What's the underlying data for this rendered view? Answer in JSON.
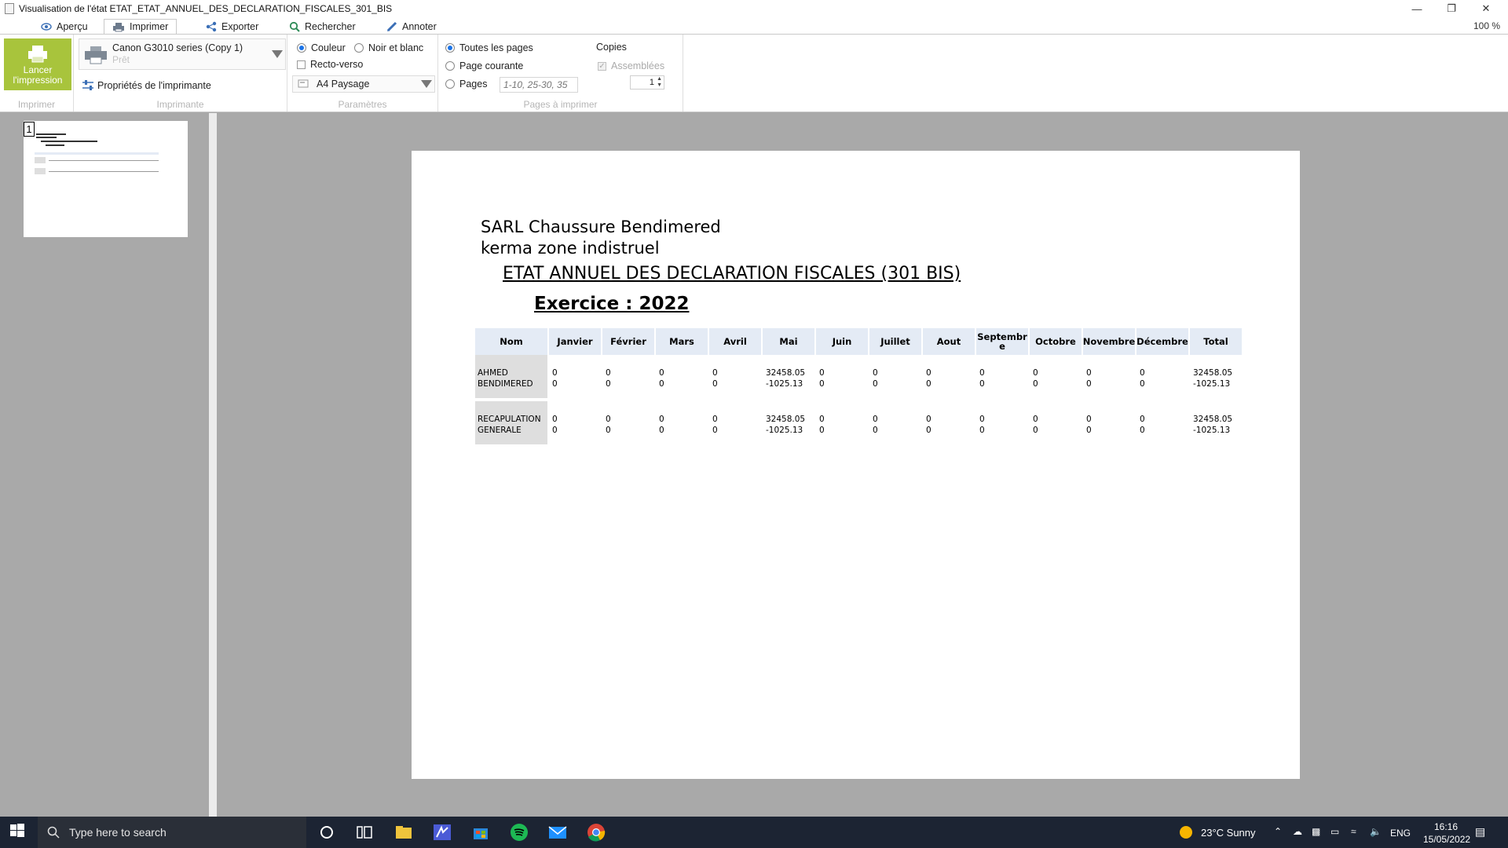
{
  "window": {
    "title": "Visualisation de l'état ETAT_ETAT_ANNUEL_DES_DECLARATION_FISCALES_301_BIS",
    "zoom": "100 %"
  },
  "tabs": [
    {
      "label": "Aperçu",
      "icon": "eye-icon"
    },
    {
      "label": "Imprimer",
      "icon": "printer-icon"
    },
    {
      "label": "Exporter",
      "icon": "share-icon"
    },
    {
      "label": "Rechercher",
      "icon": "search-icon"
    },
    {
      "label": "Annoter",
      "icon": "pencil-icon"
    }
  ],
  "ribbon": {
    "print_button": "Lancer l'impression",
    "printer_name": "Canon G3010 series (Copy 1)",
    "printer_status": "Prêt",
    "printer_props": "Propriétés de l'imprimante",
    "color": "Couleur",
    "bw": "Noir et blanc",
    "duplex": "Recto-verso",
    "paper": "A4 Paysage",
    "all_pages": "Toutes les pages",
    "current_page": "Page courante",
    "pages": "Pages",
    "pages_placeholder": "1-10, 25-30, 35",
    "copies_label": "Copies",
    "copies_value": "1",
    "collated": "Assemblées",
    "groups": {
      "print": "Imprimer",
      "printer": "Imprimante",
      "params": "Paramètres",
      "pages_to_print": "Pages à imprimer"
    },
    "accent": "#a8c43c"
  },
  "thumbnail": {
    "page_number": "1"
  },
  "report": {
    "company": "SARL Chaussure Bendimered",
    "address": "kerma zone indistruel",
    "title": "ETAT ANNUEL DES DECLARATION FISCALES (301 BIS)",
    "exercice": "Exercice : 2022",
    "columns": [
      "Nom",
      "Janvier",
      "Février",
      "Mars",
      "Avril",
      "Mai",
      "Juin",
      "Juillet",
      "Aout",
      "Septembre",
      "Octobre",
      "Novembre",
      "Décembre",
      "Total"
    ],
    "columns_wrapped_9": [
      "Septembr",
      "e"
    ],
    "rows": [
      {
        "name": [
          "AHMED",
          "BENDIMERED"
        ],
        "values": [
          [
            "0",
            "0",
            "0",
            "0",
            "32458.05",
            "0",
            "0",
            "0",
            "0",
            "0",
            "0",
            "0",
            "32458.05"
          ],
          [
            "0",
            "0",
            "0",
            "0",
            "-1025.13",
            "0",
            "0",
            "0",
            "0",
            "0",
            "0",
            "0",
            "-1025.13"
          ]
        ]
      },
      {
        "name": [
          "RECAPULATION",
          "GENERALE"
        ],
        "values": [
          [
            "0",
            "0",
            "0",
            "0",
            "32458.05",
            "0",
            "0",
            "0",
            "0",
            "0",
            "0",
            "0",
            "32458.05"
          ],
          [
            "0",
            "0",
            "0",
            "0",
            "-1025.13",
            "0",
            "0",
            "0",
            "0",
            "0",
            "0",
            "0",
            "-1025.13"
          ]
        ]
      }
    ]
  },
  "taskbar": {
    "search_placeholder": "Type here to search",
    "weather": "23°C  Sunny",
    "lang": "ENG",
    "time": "16:16",
    "date": "15/05/2022"
  }
}
